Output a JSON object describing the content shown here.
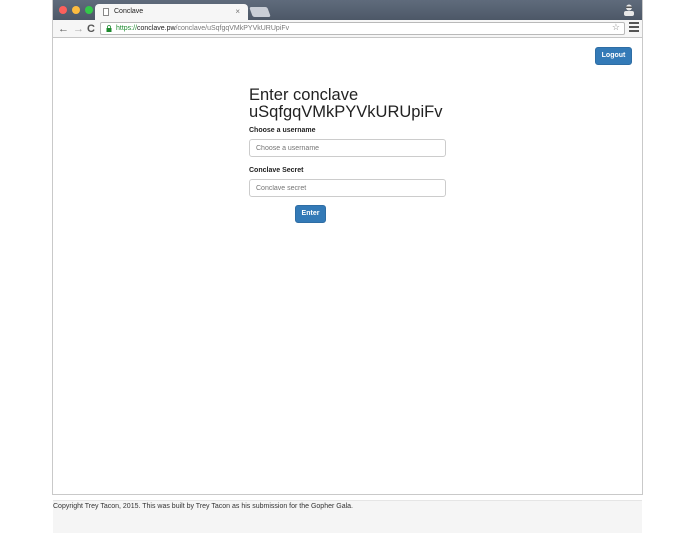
{
  "browser": {
    "tab_title": "Conclave",
    "tab_close": "×",
    "url_scheme": "https://",
    "url_host": "conclave.pw",
    "url_path": "/conclave/uSqfgqVMkPYVkURUpiFv",
    "icons": {
      "back": "arrow-left-icon",
      "forward": "arrow-right-icon",
      "reload": "reload-icon",
      "lock": "lock-icon",
      "star": "star-icon",
      "menu": "menu-icon",
      "profile": "profile-icon"
    }
  },
  "header": {
    "logout_label": "Logout"
  },
  "form": {
    "title_line1": "Enter conclave",
    "title_line2": "uSqfgqVMkPYVkURUpiFv",
    "username_label": "Choose a username",
    "username_placeholder": "Choose a username",
    "username_value": "",
    "secret_label": "Conclave Secret",
    "secret_placeholder": "Conclave secret",
    "secret_value": "",
    "submit_label": "Enter"
  },
  "footer": {
    "text": "Copyright Trey Tacon, 2015. This was built by Trey Tacon as his submission for the Gopher Gala."
  },
  "colors": {
    "primary": "#337ab7",
    "titlebar": "#5f6b7c",
    "secure_green": "#1d8a2e"
  }
}
